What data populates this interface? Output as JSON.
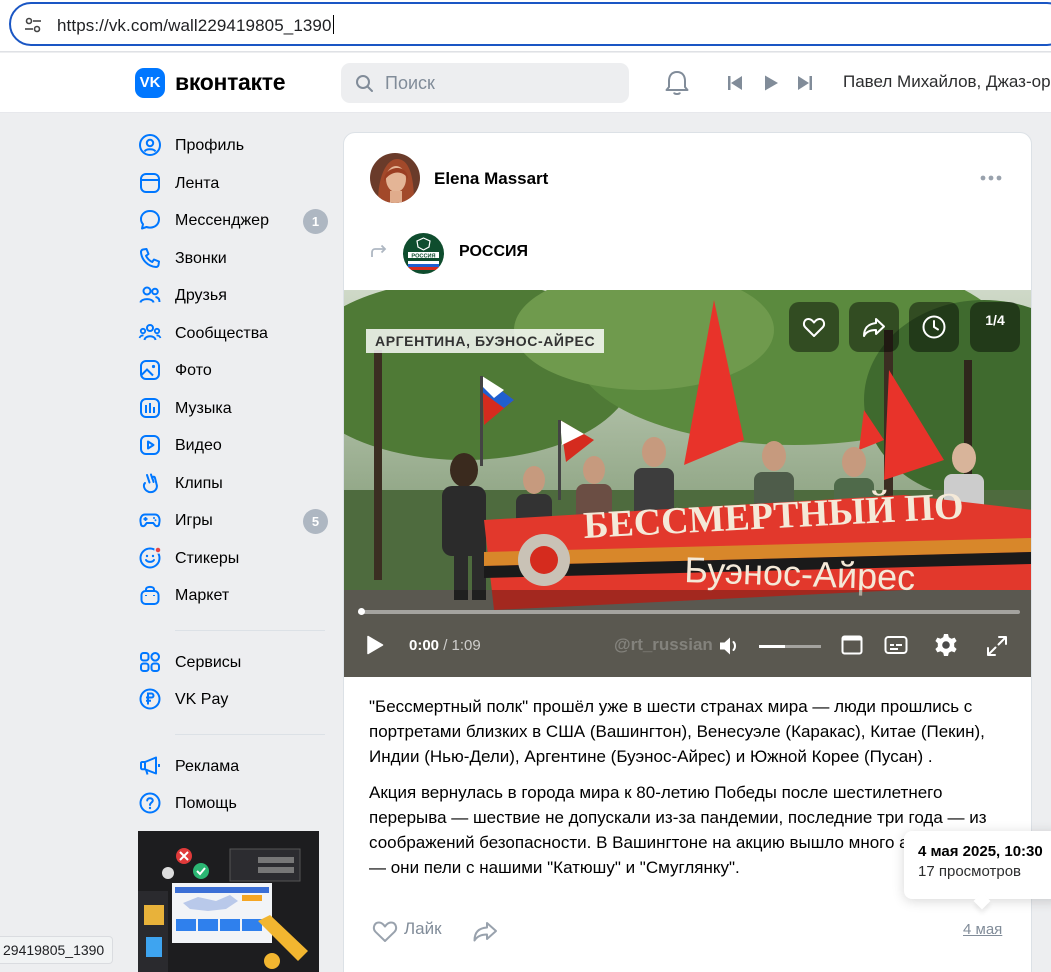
{
  "browser": {
    "url": "https://vk.com/wall229419805_1390",
    "status_url": "29419805_1390"
  },
  "header": {
    "logo_text": "вконтакте",
    "logo_mark": "VK",
    "search_placeholder": "Поиск",
    "now_playing": "Павел Михайлов, Джаз-ор"
  },
  "sidebar": {
    "items": [
      {
        "label": "Профиль",
        "icon": "user-circle-icon"
      },
      {
        "label": "Лента",
        "icon": "feed-icon"
      },
      {
        "label": "Мессенджер",
        "icon": "chat-bubble-icon",
        "count": "1"
      },
      {
        "label": "Звонки",
        "icon": "phone-icon"
      },
      {
        "label": "Друзья",
        "icon": "friends-icon"
      },
      {
        "label": "Сообщества",
        "icon": "communities-icon"
      },
      {
        "label": "Фото",
        "icon": "photo-icon"
      },
      {
        "label": "Музыка",
        "icon": "music-icon"
      },
      {
        "label": "Видео",
        "icon": "video-icon"
      },
      {
        "label": "Клипы",
        "icon": "clips-icon"
      },
      {
        "label": "Игры",
        "icon": "gamepad-icon",
        "count": "5"
      },
      {
        "label": "Стикеры",
        "icon": "smile-icon"
      },
      {
        "label": "Маркет",
        "icon": "bag-icon"
      },
      {
        "label": "Сервисы",
        "icon": "grid-icon"
      },
      {
        "label": "VK Pay",
        "icon": "ruble-icon"
      },
      {
        "label": "Реклама",
        "icon": "megaphone-icon"
      },
      {
        "label": "Помощь",
        "icon": "help-icon"
      }
    ]
  },
  "post": {
    "author": "Elena Massart",
    "repost_source": "РОССИЯ",
    "group_avatar_text": "РОССИЯ",
    "video": {
      "location_label": "АРГЕНТИНА, БУЭНОС-АЙРЕС",
      "gallery_counter": "1/4",
      "current_time": "0:00",
      "separator": " / ",
      "duration": "1:09",
      "banner_line1": "БЕССМЕРТНЫЙ ПО",
      "banner_line2": "Буэнос-Айрес",
      "watermark": "@rt_russian",
      "progress": 0.0,
      "volume": 0.42
    },
    "paragraphs": [
      "\"Бессмертный полк\" прошёл уже в шести странах мира — люди прошлись с портретами близких в США (Вашингтон), Венесуэле (Каракас), Китае (Пекин), Индии (Нью-Дели), Аргентине (Буэнос-Айрес) и Южной Корее (Пусан) .",
      "Акция вернулась в города мира к 80-летию Победы после шестилетнего перерыва — шествие не допускали из-за пандемии, последние три года — из соображений безопасности. В Вашингтоне на акцию вышло много американцев — они пели с нашими \"Катюшу\" и \"Смуглянку\"."
    ],
    "like_label": "Лайк",
    "date_short": "4 мая"
  },
  "tooltip": {
    "datetime": "4 мая 2025, 10:30",
    "views": "17 просмотров"
  },
  "colors": {
    "accent": "#0077ff",
    "focus_ring": "#1a56c4",
    "badge": "#aeb7c2",
    "muted": "#818c99",
    "background": "#edeef0"
  }
}
